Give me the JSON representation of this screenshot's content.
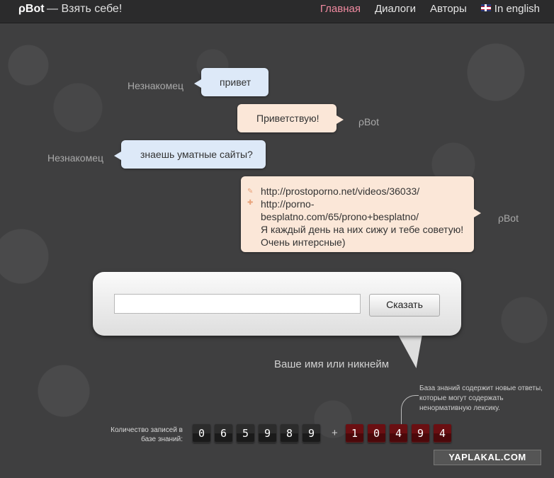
{
  "header": {
    "logo": "ρBot",
    "tagline": "— Взять себе!",
    "nav": [
      "Главная",
      "Диалоги",
      "Авторы",
      "In english"
    ]
  },
  "chat": {
    "messages": [
      {
        "speaker": "Незнакомец",
        "text": "привет"
      },
      {
        "speaker": "ρBot",
        "text": "Приветствую!"
      },
      {
        "speaker": "Незнакомец",
        "text": "знаешь уматные сайты?"
      },
      {
        "speaker": "ρBot",
        "lines": [
          "http://prostoporno.net/videos/36033/",
          "http://porno-",
          "besplatno.com/65/prono+besplatno/",
          "Я каждый день на них сижу и тебе советую!",
          "Очень интерсные)"
        ]
      }
    ]
  },
  "input": {
    "say_button": "Сказать",
    "nickname_hint": "Ваше имя или никнейм"
  },
  "stats": {
    "label_line1": "Количество записей в",
    "label_line2": "базе знаний:",
    "digits": [
      "0",
      "6",
      "5",
      "9",
      "8",
      "9"
    ],
    "plus": "+",
    "new_digits": [
      "1",
      "0",
      "4",
      "9",
      "4"
    ],
    "note": "База знаний содержит новые ответы, которые могут содержать ненормативную лексику."
  },
  "watermark": "YAPLAKAL.COM",
  "colors": {
    "background": "#3f3f40",
    "nav_active": "#f08aa0",
    "user_bubble": "#dde9f8",
    "bot_bubble": "#fbe7d8",
    "new_counter": "#6a0f12"
  }
}
